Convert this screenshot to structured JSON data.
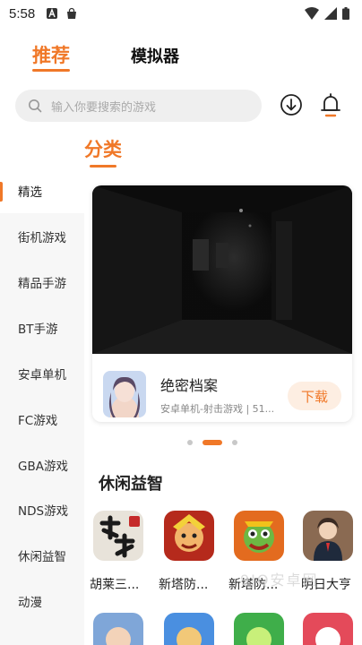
{
  "status_bar": {
    "time": "5:58"
  },
  "top_tabs": [
    {
      "label": "推荐",
      "active": true
    },
    {
      "label": "模拟器",
      "active": false
    }
  ],
  "search": {
    "placeholder": "输入你要搜索的游戏"
  },
  "category_title": "分类",
  "sidebar": {
    "items": [
      {
        "label": "精选",
        "active": true
      },
      {
        "label": "街机游戏"
      },
      {
        "label": "精品手游"
      },
      {
        "label": "BT手游"
      },
      {
        "label": "安卓单机"
      },
      {
        "label": "FC游戏"
      },
      {
        "label": "GBA游戏"
      },
      {
        "label": "NDS游戏"
      },
      {
        "label": "休闲益智"
      },
      {
        "label": "动漫"
      }
    ]
  },
  "banner": {
    "title": "绝密档案",
    "meta": "安卓单机-射击游戏 | 51...",
    "download_label": "下载"
  },
  "carousel": {
    "pages": 3,
    "current": 2
  },
  "section": {
    "title": "休闲益智",
    "games": [
      {
        "name": "胡莱三..."
      },
      {
        "name": "新塔防..."
      },
      {
        "name": "新塔防..."
      },
      {
        "name": "明日大亨"
      }
    ]
  },
  "watermark": "9JQ安卓网",
  "colors": {
    "accent": "#f07828",
    "sidebar_bg": "#f7f7f7",
    "search_bg": "#efefef"
  }
}
